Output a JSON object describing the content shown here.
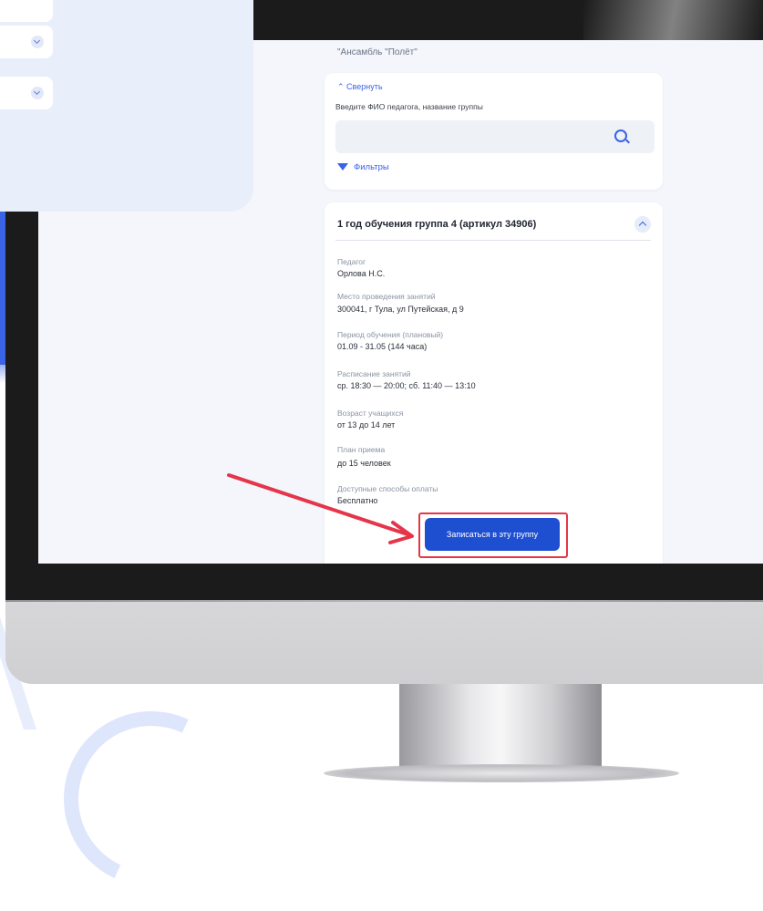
{
  "page": {
    "heading": "\"Ансамбль \"Полёт\""
  },
  "search": {
    "collapse_label": "⌃ Свернуть",
    "label": "Введите ФИО педагога, название группы",
    "placeholder": "",
    "filters_label": "Фильтры"
  },
  "group": {
    "title": "1 год обучения группа 4 (артикул 34906)",
    "fields": [
      {
        "label": "Педагог",
        "value": "Орлова Н.С."
      },
      {
        "label": "Место проведения занятий",
        "value": "300041, г Тула, ул Путейская, д 9"
      },
      {
        "label": "Период обучения (плановый)",
        "value": "01.09 - 31.05 (144 часа)"
      },
      {
        "label": "Расписание занятий",
        "value": "ср. 18:30 — 20:00; сб. 11:40 — 13:10"
      },
      {
        "label": "Возраст учащихся",
        "value": "от 13 до 14 лет"
      },
      {
        "label": "План приема",
        "value": "до 15 человек"
      },
      {
        "label": "Доступные способы оплаты",
        "value": "Бесплатно"
      }
    ],
    "enroll_label": "Записаться в эту группу"
  },
  "colors": {
    "accent": "#3b63e6",
    "button": "#1f4fd1",
    "highlight": "#e5354a"
  }
}
